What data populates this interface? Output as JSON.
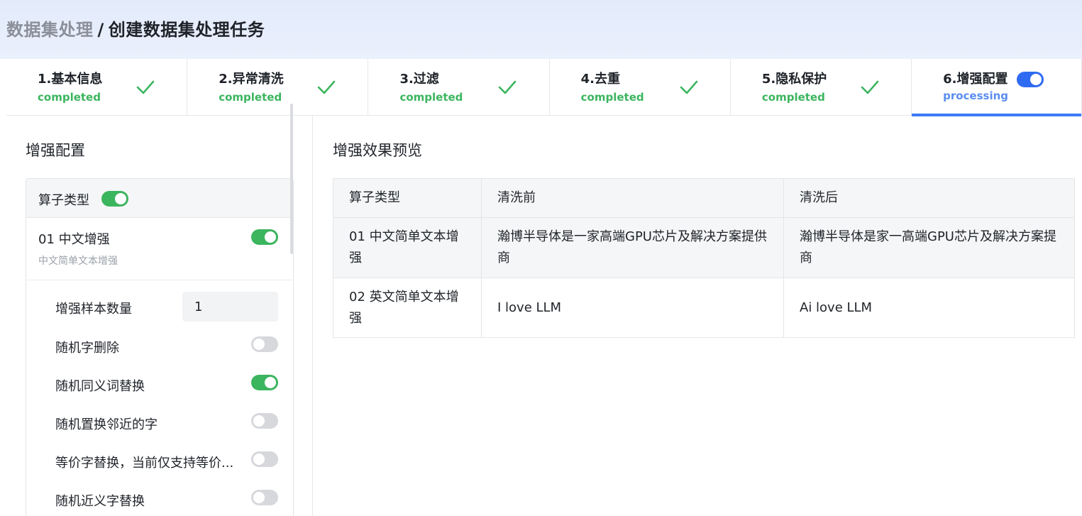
{
  "breadcrumb": {
    "parent": "数据集处理",
    "separator": "/",
    "current": "创建数据集处理任务"
  },
  "steps": [
    {
      "title": "1.基本信息",
      "status": "completed",
      "icon": "check-icon"
    },
    {
      "title": "2.异常清洗",
      "status": "completed",
      "icon": "check-icon"
    },
    {
      "title": "3.过滤",
      "status": "completed",
      "icon": "check-icon"
    },
    {
      "title": "4.去重",
      "status": "completed",
      "icon": "check-icon"
    },
    {
      "title": "5.隐私保护",
      "status": "completed",
      "icon": "check-icon"
    },
    {
      "title": "6.增强配置",
      "status": "processing",
      "icon": "toggle-icon"
    }
  ],
  "config": {
    "title": "增强配置",
    "operator_type_label": "算子类型",
    "operator_type_enabled": true,
    "operator": {
      "name": "01 中文增强",
      "description": "中文简单文本增强",
      "enabled": true
    },
    "params": [
      {
        "label": "增强样本数量",
        "type": "number",
        "value": "1"
      },
      {
        "label": "随机字删除",
        "type": "toggle",
        "enabled": false
      },
      {
        "label": "随机同义词替换",
        "type": "toggle",
        "enabled": true
      },
      {
        "label": "随机置换邻近的字",
        "type": "toggle",
        "enabled": false
      },
      {
        "label": "等价字替换，当前仅支持等价...",
        "type": "toggle",
        "enabled": false
      },
      {
        "label": "随机近义字替换",
        "type": "toggle",
        "enabled": false
      }
    ]
  },
  "preview": {
    "title": "增强效果预览",
    "columns": [
      "算子类型",
      "清洗前",
      "清洗后"
    ],
    "rows": [
      [
        "01 中文简单文本增强",
        "瀚博半导体是一家高端GPU芯片及解决方案提供商",
        "瀚博半导体是家一高端GPU芯片及解决方案提商"
      ],
      [
        "02 英文简单文本增强",
        "I love LLM",
        "Ai love LLM"
      ]
    ]
  },
  "colors": {
    "completed": "#3cb55f",
    "processing": "#5b8def",
    "accent": "#3b7cf6",
    "toggle_on": "#3cb55f",
    "toggle_off": "#d6d8dc"
  }
}
